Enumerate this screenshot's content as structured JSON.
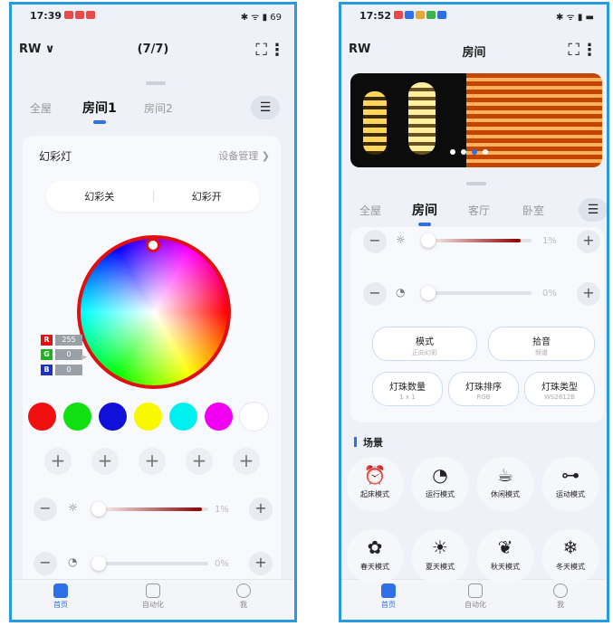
{
  "left": {
    "status": {
      "time": "17:39",
      "right": "✱ ᯤ ▮ 69"
    },
    "header": {
      "title": "RW ∨",
      "center": "(7/7)"
    },
    "tabs": [
      {
        "label": "全屋"
      },
      {
        "label": "房间1"
      },
      {
        "label": "房间2"
      }
    ],
    "device": {
      "name": "幻彩灯",
      "manage": "设备管理 ❯"
    },
    "segment": {
      "off": "幻彩关",
      "on": "幻彩开"
    },
    "rgb": {
      "r_label": "R",
      "r": "255",
      "g_label": "G",
      "g": "0",
      "b_label": "B",
      "b": "0"
    },
    "swatches": [
      "#f01010",
      "#10e010",
      "#1010d8",
      "#f8f800",
      "#00f0f0",
      "#f000f0",
      "#ffffff"
    ],
    "brightness": {
      "minus": "−",
      "plus": "+",
      "value": "1%",
      "fill_fraction": 0.94
    },
    "speed": {
      "minus": "−",
      "plus": "+",
      "value": "0%"
    },
    "nav": {
      "home": "首页",
      "auto": "自动化",
      "me": "我"
    }
  },
  "right": {
    "status": {
      "time": "17:52",
      "right": "✱ ᯤ ▮ ▬"
    },
    "header": {
      "title": "RW",
      "center": "房间"
    },
    "tabs": [
      {
        "label": "全屋"
      },
      {
        "label": "房间"
      },
      {
        "label": "客厅"
      },
      {
        "label": "卧室"
      }
    ],
    "brightness": {
      "minus": "−",
      "plus": "+",
      "value": "1%",
      "fill_fraction": 0.9
    },
    "speed": {
      "minus": "−",
      "plus": "+",
      "value": "0%"
    },
    "mode": {
      "label": "模式",
      "sub": "正向幻彩"
    },
    "sound": {
      "label": "拾音",
      "sub": "频谱"
    },
    "count": {
      "label": "灯珠数量",
      "sub": "1 x 1"
    },
    "order": {
      "label": "灯珠排序",
      "sub": "RGB"
    },
    "type": {
      "label": "灯珠类型",
      "sub": "WS2812B"
    },
    "scenes_title": "场景",
    "scenes": [
      {
        "label": "起床模式",
        "icon": "wake-icon",
        "glyph": "⏰"
      },
      {
        "label": "运行模式",
        "icon": "run-icon",
        "glyph": "◔"
      },
      {
        "label": "休闲模式",
        "icon": "coffee-icon",
        "glyph": "☕"
      },
      {
        "label": "运动模式",
        "icon": "dumbbell-icon",
        "glyph": "⊶"
      },
      {
        "label": "春天模式",
        "icon": "flower-icon",
        "glyph": "✿"
      },
      {
        "label": "夏天模式",
        "icon": "sun-icon",
        "glyph": "☀"
      },
      {
        "label": "秋天模式",
        "icon": "leaf-icon",
        "glyph": "❦"
      },
      {
        "label": "冬天模式",
        "icon": "snowflake-icon",
        "glyph": "❄"
      }
    ],
    "nav": {
      "home": "首页",
      "auto": "自动化",
      "me": "我"
    }
  }
}
